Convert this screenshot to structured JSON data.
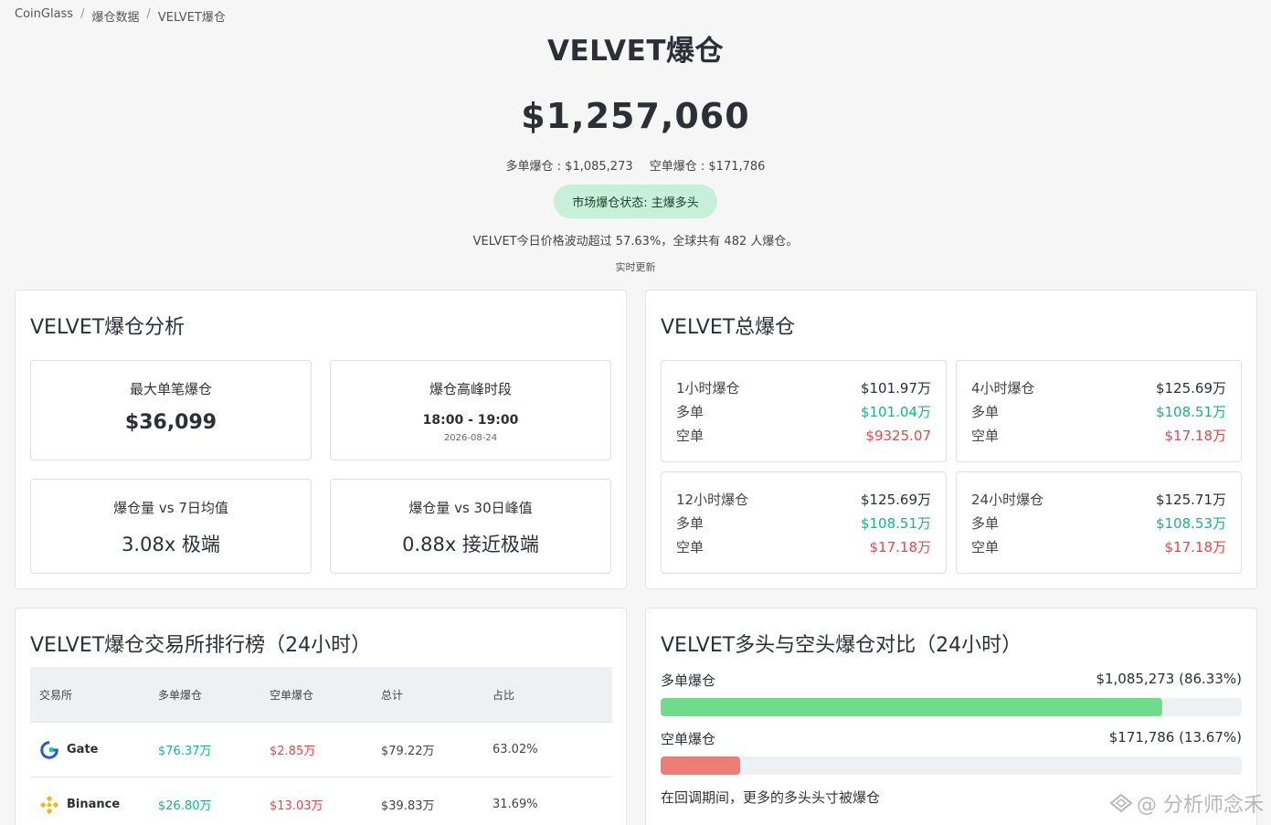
{
  "breadcrumb": [
    "CoinGlass",
    "爆仓数据",
    "VELVET爆仓"
  ],
  "hero": {
    "title": "VELVET爆仓",
    "total": "$1,257,060",
    "long_text": "多单爆仓 : $1,085,273",
    "short_text": "空单爆仓 : $171,786",
    "status": "市场爆仓状态: 主爆多头",
    "desc": "VELVET今日价格波动超过 57.63%，全球共有 482 人爆仓。",
    "live": "实时更新"
  },
  "analysis": {
    "title": "VELVET爆仓分析",
    "max_single_label": "最大单笔爆仓",
    "max_single_value": "$36,099",
    "peak_label": "爆仓高峰时段",
    "peak_time": "18:00 - 19:00",
    "peak_date": "2026-08-24",
    "vs7_label": "爆仓量 vs 7日均值",
    "vs7_value": "3.08x 极端",
    "vs30_label": "爆仓量 vs 30日峰值",
    "vs30_value": "0.88x 接近极端"
  },
  "totals": {
    "title": "VELVET总爆仓",
    "long_label": "多单",
    "short_label": "空单",
    "tiles": [
      {
        "period": "1小时爆仓",
        "total": "$101.97万",
        "long": "$101.04万",
        "short": "$9325.07"
      },
      {
        "period": "4小时爆仓",
        "total": "$125.69万",
        "long": "$108.51万",
        "short": "$17.18万"
      },
      {
        "period": "12小时爆仓",
        "total": "$125.69万",
        "long": "$108.51万",
        "short": "$17.18万"
      },
      {
        "period": "24小时爆仓",
        "total": "$125.71万",
        "long": "$108.53万",
        "short": "$17.18万"
      }
    ]
  },
  "ranking": {
    "title": "VELVET爆仓交易所排行榜（24小时）",
    "headers": [
      "交易所",
      "多单爆仓",
      "空单爆仓",
      "总计",
      "占比"
    ],
    "rows": [
      {
        "exchange": "Gate",
        "long": "$76.37万",
        "short": "$2.85万",
        "total": "$79.22万",
        "share": "63.02%"
      },
      {
        "exchange": "Binance",
        "long": "$26.80万",
        "short": "$13.03万",
        "total": "$39.83万",
        "share": "31.69%"
      }
    ]
  },
  "compare": {
    "title": "VELVET多头与空头爆仓对比（24小时）",
    "long_label": "多单爆仓",
    "long_value": "$1,085,273 (86.33%)",
    "long_pct": 86.33,
    "short_label": "空单爆仓",
    "short_value": "$171,786 (13.67%)",
    "short_pct": 13.67,
    "note": "在回调期间，更多的多头头寸被爆仓",
    "long_color": "#6fdc8c",
    "short_color": "#ee7d77"
  },
  "watermark": "@ 分析师念禾",
  "colors": {
    "green": "#10b981",
    "red": "#ef4444",
    "status_bg": "#c7f0d8"
  }
}
